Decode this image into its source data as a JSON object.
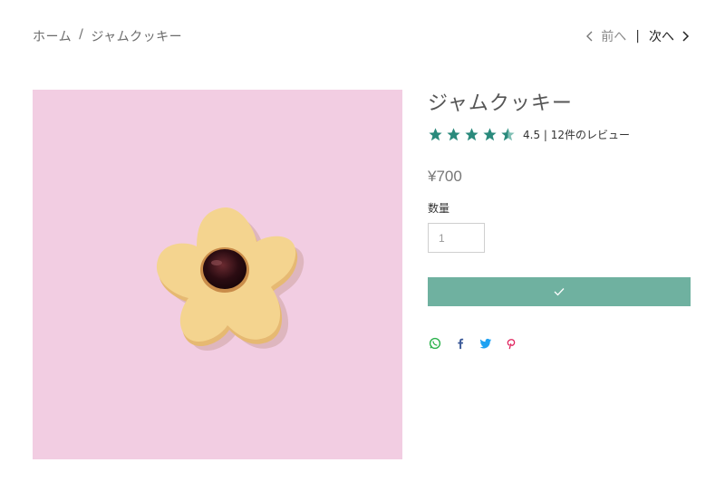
{
  "breadcrumb": {
    "home": "ホーム",
    "separator": "/",
    "current": "ジャムクッキー"
  },
  "pager": {
    "prev_label": "前へ",
    "separator": "|",
    "next_label": "次へ"
  },
  "product": {
    "title": "ジャムクッキー",
    "rating_value": 4.5,
    "rating_text": "4.5 | 12件のレビュー",
    "price": "¥700",
    "quantity_label": "数量",
    "quantity_value": "1",
    "add_button_icon": "checkmark-icon"
  },
  "colors": {
    "accent": "#6fb1a0",
    "star": "#2a8a7c",
    "image_background": "#f2cde2"
  },
  "share": {
    "icons": [
      "whatsapp-icon",
      "facebook-icon",
      "twitter-icon",
      "pinterest-icon"
    ]
  }
}
